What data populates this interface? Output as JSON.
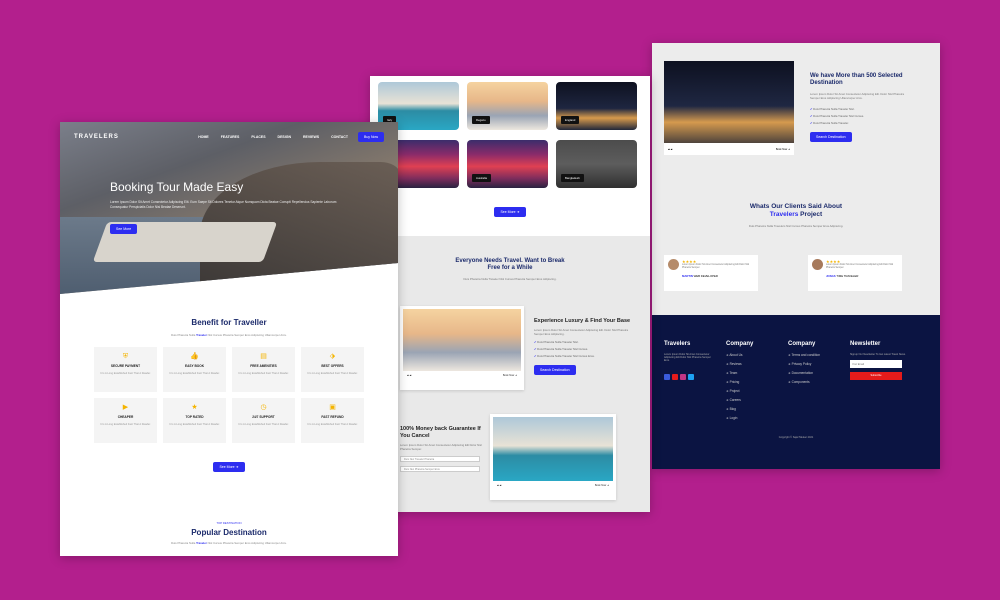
{
  "page1": {
    "logo": "TRAVELERS",
    "menu": [
      "HOME",
      "FEATURES",
      "PLACES",
      "DESIGN",
      "REVIEWS",
      "CONTACT"
    ],
    "book_btn": "Buy Now",
    "hero_title": "Booking Tour Made Easy",
    "hero_desc": "Lorem Ipsum Dolor Sit Amet Consectetur Adipiscing Elit. Eum Saepe Sit Dolores Tenetur Atque Numquam Dicta Beatae Corrupti Repellendus Sapiente Laborum Consequatur Perspiciatis Dolor Nisi Beatae Deserunt.",
    "hero_btn": "See More",
    "benefit_title": "Benefit for Traveller",
    "benefit_sub_a": "Duis Pharetra Nulla",
    "benefit_sub_brand": "Traveler",
    "benefit_sub_b": "Nisl Cursus Pharetra Semper Eros Adipiscing Ullamcorper Arcu.",
    "cards": [
      {
        "icon": "shield-icon",
        "glyph": "⛨",
        "title": "SECURE PAYMENT",
        "desc": "It Is A Long Established Fact That A Reader."
      },
      {
        "icon": "thumbs-up-icon",
        "glyph": "👍",
        "title": "EASY BOOK",
        "desc": "It Is A Long Established Fact That A Reader."
      },
      {
        "icon": "ticket-icon",
        "glyph": "▤",
        "title": "FREE AMENITIES",
        "desc": "It Is A Long Established Fact That A Reader."
      },
      {
        "icon": "tag-icon",
        "glyph": "⬗",
        "title": "BEST OFFERS",
        "desc": "It Is A Long Established Fact That A Reader."
      },
      {
        "icon": "video-icon",
        "glyph": "▶",
        "title": "CHEAPER",
        "desc": "It Is A Long Established Fact That A Reader."
      },
      {
        "icon": "star-icon",
        "glyph": "★",
        "title": "TOP RATED",
        "desc": "It Is A Long Established Fact That A Reader."
      },
      {
        "icon": "clock-icon",
        "glyph": "◷",
        "title": "24/7 SUPPORT",
        "desc": "It Is A Long Established Fact That A Reader."
      },
      {
        "icon": "briefcase-icon",
        "glyph": "▣",
        "title": "FAST REFUND",
        "desc": "It Is A Long Established Fact That A Reader."
      }
    ],
    "more_btn": "See More ➜",
    "popular_eyebrow": "TOP DESTINATION",
    "popular_title": "Popular Destination",
    "popular_sub_a": "Duis Pharetra Nulla",
    "popular_sub_brand": "Traveler",
    "popular_sub_b": "Nisl Cursus Pharetra Semper Eros Adipiscing Ullamcorper Arcu."
  },
  "page2": {
    "destinations": [
      {
        "label": "Italy",
        "img": "pool"
      },
      {
        "label": "Regazo",
        "img": "sunset"
      },
      {
        "label": "England",
        "img": "night"
      },
      {
        "label": "",
        "img": "red"
      },
      {
        "label": "Australia",
        "img": "red"
      },
      {
        "label": "Bangladesh",
        "img": "dark"
      }
    ],
    "see_more": "See More ➜",
    "need_title": "Everyone Needs Travel. Want to Break Free for a While",
    "need_desc": "Duis Pharetra Nulla Traveler Nisl Cursus Pharetra Semper Eros Adipiscing.",
    "luxury_title": "Experience Luxury & Find Your Base",
    "luxury_desc": "Lorem Ipsum Dolor Sit Amet Consectetur Adipiscing Elit. Dolor Nisl Pharetra Semper Eros Adipiscing.",
    "luxury_checks": [
      "Duis Pharetra Nulla Traveler Nisl.",
      "Duis Pharetra Nulla Traveler Nisl Cursus.",
      "Duis Pharetra Nulla Traveler Nisl Cursus Eros."
    ],
    "luxury_btn": "Search Destination",
    "card_left": "▰ ▰",
    "card_right": "Book Now ➜",
    "refund_title": "100% Money back Guarantee If You Cancel",
    "refund_desc": "Lorem Ipsum Dolor Sit Amet Consectetur Adipiscing Elit Dolor Nisl Pharetra Semper.",
    "select1": "Duis Nec Traveler Pharetra",
    "select2": "Duis Nec Pharetra Semper Eros"
  },
  "page3": {
    "stat_title": "We have More than 500 Selected Destination",
    "stat_desc": "Lorem Ipsum Dolor Sit Amet Consectetur Adipiscing Elit. Dolor Nisl Pharetra Semper Eros Adipiscing Ullamcorper Arcu.",
    "stat_checks": [
      "Duis Pharetra Nulla Traveler Nisl.",
      "Duis Pharetra Nulla Traveler Nisl Cursus.",
      "Duis Pharetra Nulla Traveler."
    ],
    "stat_btn": "Search Destination",
    "clients_title_a": "Whats Our Clients Said About",
    "clients_brand": "Travelers",
    "clients_title_b": "Project",
    "clients_desc": "Duis Pharetra Nulla Travelers Nisl Cursus Pharetra Semper Eros Adipiscing.",
    "testimonials": [
      {
        "stars": "★★★★",
        "text": "Lorem Ipsum Dolor Sit Amet Consectetur Adipiscing Elit Dolor Nisl Pharetra Semper.",
        "name": "MARTIN",
        "role": "WEB DEVELOPER"
      },
      {
        "stars": "★★★★",
        "text": "Lorem Ipsum Dolor Sit Amet Consectetur Adipiscing Elit Dolor Nisl Pharetra Semper.",
        "name": "JONAS",
        "role": "TIME TRAVELER"
      }
    ],
    "footer": {
      "brand": "Travelers",
      "brand_desc": "Lorem Ipsum Dolor Sit Amet Consectetur Adipiscing Elit Dolor Nisl Pharetra Semper Eros.",
      "col1_title": "Company",
      "col1": [
        "About Us",
        "Reviews",
        "Team",
        "Pricing",
        "Project",
        "Careers",
        "Blog",
        "Login"
      ],
      "col2_title": "Company",
      "col2": [
        "Terms and condition",
        "Privacy Policy",
        "Documentation",
        "Components"
      ],
      "news_title": "Newsletter",
      "news_desc": "Signup Our Newsletter To Get Latest Travel News.",
      "email_placeholder": "Your Email",
      "subscribe": "Subscribe",
      "copyright": "Copyright © Sajal Taluker 2021"
    }
  },
  "colors": {
    "background": "#b31f8d",
    "accent": "#2d2df0",
    "title": "#1b2a6b",
    "footer": "#0b1442",
    "star": "#f4b400",
    "subscribe": "#e41b1b"
  }
}
